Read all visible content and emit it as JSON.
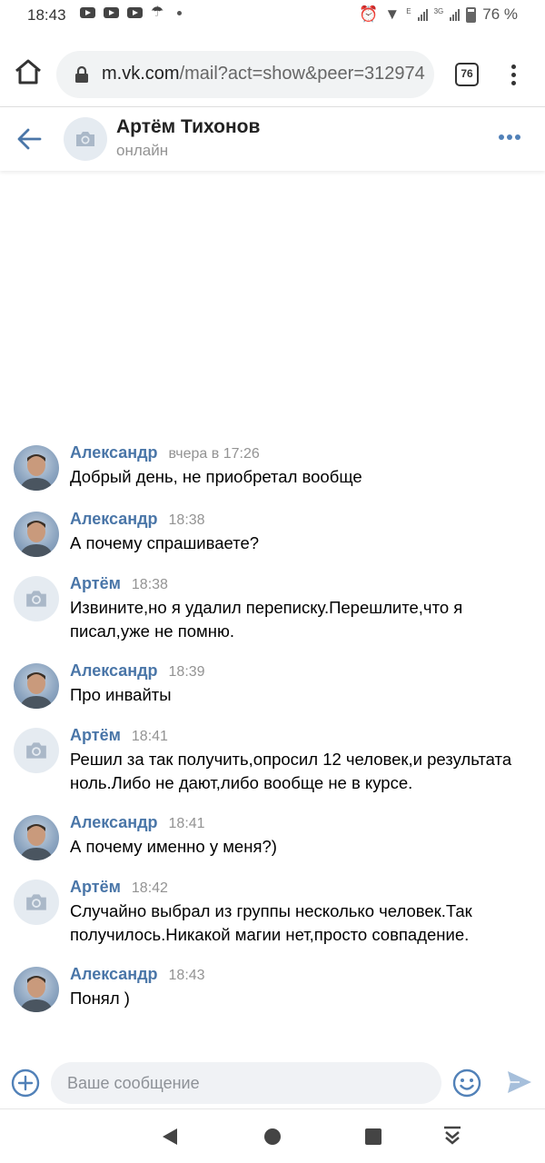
{
  "status_bar": {
    "time": "18:43",
    "network_e": "E",
    "network_3g": "3G",
    "battery": "76 %"
  },
  "browser": {
    "url_domain": "m.vk.com",
    "url_path": "/mail?act=show&peer=312974",
    "tab_count": "76"
  },
  "chat_header": {
    "name": "Артём Тихонов",
    "status": "онлайн"
  },
  "messages": [
    {
      "author": "Александр",
      "time": "вчера в 17:26",
      "text": "Добрый день, не приобретал вообще",
      "avatar": "photo"
    },
    {
      "author": "Александр",
      "time": "18:38",
      "text": "А почему спрашиваете?",
      "avatar": "photo"
    },
    {
      "author": "Артём",
      "time": "18:38",
      "text": "Извините,но я удалил переписку.Перешлите,что я писал,уже не помню.",
      "avatar": "camera"
    },
    {
      "author": "Александр",
      "time": "18:39",
      "text": "Про инвайты",
      "avatar": "photo"
    },
    {
      "author": "Артём",
      "time": "18:41",
      "text": "Решил за так получить,опросил 12 человек,и результата ноль.Либо не дают,либо вообще не в курсе.",
      "avatar": "camera"
    },
    {
      "author": "Александр",
      "time": "18:41",
      "text": "А почему именно у меня?)",
      "avatar": "photo"
    },
    {
      "author": "Артём",
      "time": "18:42",
      "text": "Случайно выбрал из группы несколько человек.Так получилось.Никакой магии нет,просто совпадение.",
      "avatar": "camera"
    },
    {
      "author": "Александр",
      "time": "18:43",
      "text": "Понял )",
      "avatar": "photo"
    }
  ],
  "composer": {
    "placeholder": "Ваше сообщение"
  },
  "colors": {
    "vk_blue": "#4a76a8",
    "accent": "#5181b8"
  }
}
